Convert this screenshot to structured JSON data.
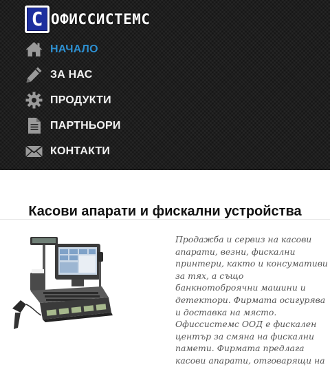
{
  "header": {
    "logo_letter": "С",
    "logo_text": "ОФИССИСТЕМС",
    "background_color": "#1e1e1e"
  },
  "nav": {
    "active_color": "#2d8fd0",
    "items": [
      {
        "label": "НАЧАЛО",
        "icon": "home-icon",
        "active": true
      },
      {
        "label": "ЗА НАС",
        "icon": "pencil-icon",
        "active": false
      },
      {
        "label": "ПРОДУКТИ",
        "icon": "gear-icon",
        "active": false
      },
      {
        "label": "ПАРТНЬОРИ",
        "icon": "document-icon",
        "active": false
      },
      {
        "label": "КОНТАКТИ",
        "icon": "envelope-icon",
        "active": false
      }
    ]
  },
  "main": {
    "title": "Касови апарати и фискални устройства",
    "image_icon": "cash-register-pos-image",
    "intro": "Продажба и сервиз на касови апарати, везни, фискални принтери, както и консумативи за тях, а също банкнотоброячни машини и детектори. Фирмата осигурява и доставка на място. Офиссистемс ООД е фискален център за смяна на фискални памети. Фирмата предлага касови апарати, отговарящи на"
  }
}
